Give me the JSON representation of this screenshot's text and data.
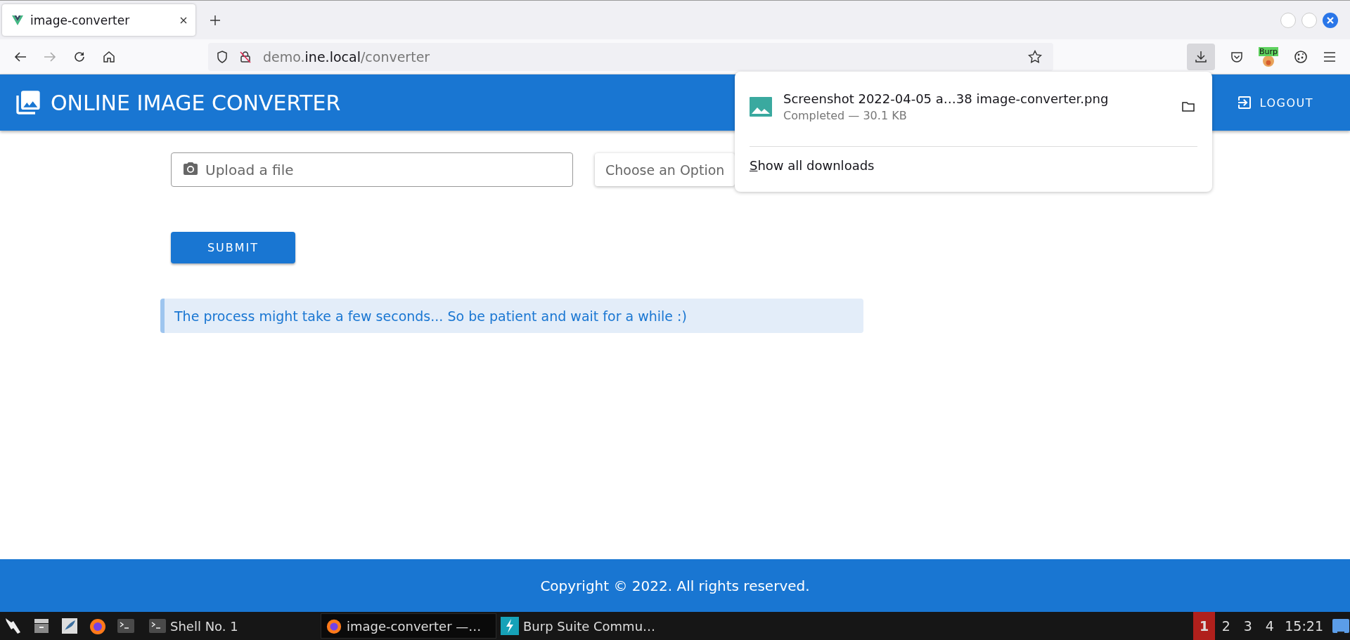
{
  "browser": {
    "tabs": [
      {
        "title": "image-converter",
        "selected": true
      }
    ],
    "url": {
      "host_prefix": "demo.",
      "host": "ine.local",
      "path": "/converter"
    },
    "extension_badge": "Burp"
  },
  "downloads_panel": {
    "items": [
      {
        "name": "Screenshot 2022-04-05 a…38 image-converter.png",
        "status": "Completed — 30.1 KB"
      }
    ],
    "show_all": "Show all downloads"
  },
  "app_bar": {
    "title": "ONLINE IMAGE CONVERTER",
    "logout": "LOGOUT"
  },
  "form": {
    "file_field": {
      "placeholder": "Upload a file"
    },
    "select": {
      "placeholder": "Choose an Option"
    },
    "submit": "SUBMIT"
  },
  "alert": "The process might take a few seconds... So be patient and wait for a while :)",
  "footer": "Copyright © 2022. All rights reserved.",
  "taskbar": {
    "tasks": [
      {
        "label": "Shell No. 1",
        "kind": "terminal",
        "selected": false
      },
      {
        "label": "image-converter —…",
        "kind": "browser",
        "selected": true
      },
      {
        "label": "Burp Suite Commu…",
        "kind": "burp",
        "selected": false
      }
    ],
    "workspaces": [
      {
        "label": "1",
        "selected": true
      },
      {
        "label": "2",
        "selected": false
      },
      {
        "label": "3",
        "selected": false
      },
      {
        "label": "4",
        "selected": false
      }
    ],
    "clock": "15:21"
  }
}
